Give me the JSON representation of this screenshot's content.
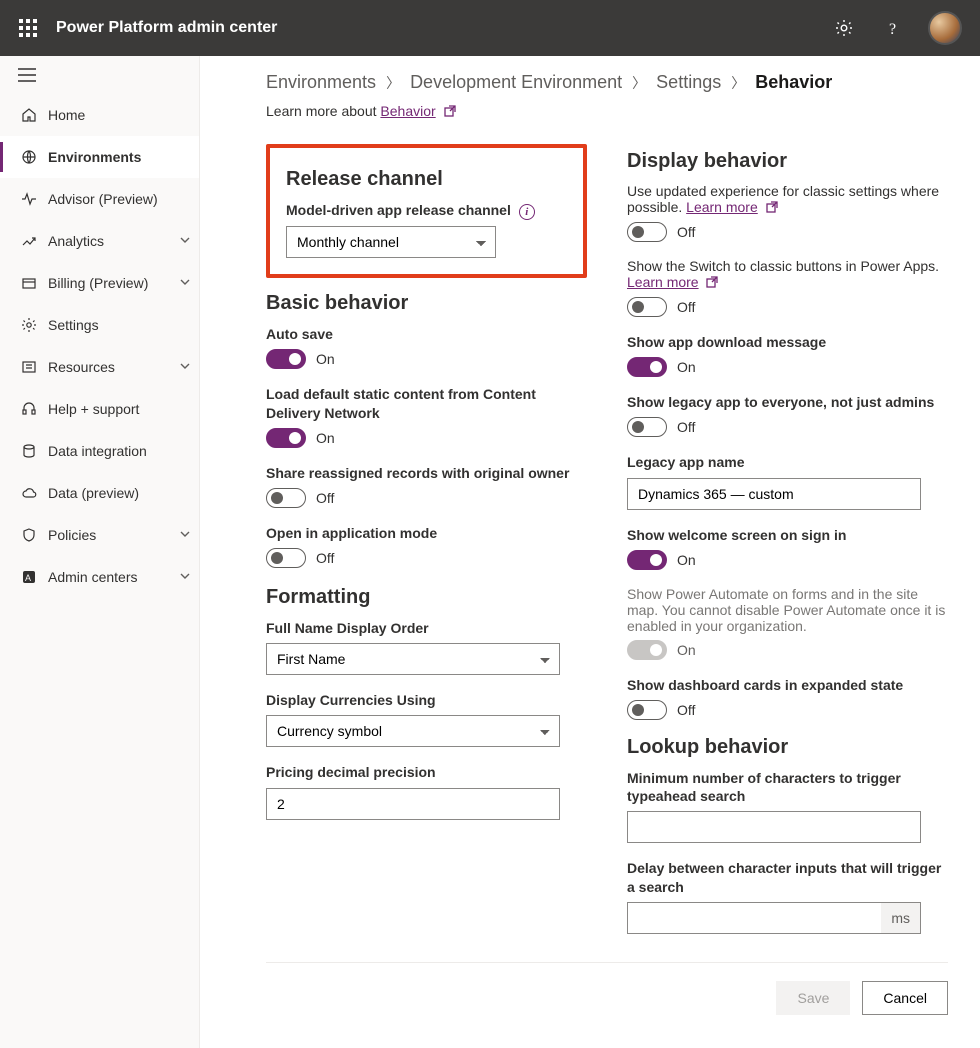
{
  "header": {
    "title": "Power Platform admin center"
  },
  "sidebar": {
    "items": [
      {
        "label": "Home"
      },
      {
        "label": "Environments"
      },
      {
        "label": "Advisor (Preview)"
      },
      {
        "label": "Analytics"
      },
      {
        "label": "Billing (Preview)"
      },
      {
        "label": "Settings"
      },
      {
        "label": "Resources"
      },
      {
        "label": "Help + support"
      },
      {
        "label": "Data integration"
      },
      {
        "label": "Data (preview)"
      },
      {
        "label": "Policies"
      },
      {
        "label": "Admin centers"
      }
    ]
  },
  "breadcrumbs": {
    "items": [
      "Environments",
      "Development Environment",
      "Settings",
      "Behavior"
    ]
  },
  "learn": {
    "prefix": "Learn more about ",
    "link": "Behavior"
  },
  "release": {
    "heading": "Release channel",
    "label": "Model-driven app release channel",
    "value": "Monthly channel"
  },
  "basic": {
    "heading": "Basic behavior",
    "auto_save": {
      "label": "Auto save",
      "state": "On"
    },
    "cdn": {
      "label": "Load default static content from Content Delivery Network",
      "state": "On"
    },
    "share": {
      "label": "Share reassigned records with original owner",
      "state": "Off"
    },
    "appmode": {
      "label": "Open in application mode",
      "state": "Off"
    }
  },
  "formatting": {
    "heading": "Formatting",
    "fullname": {
      "label": "Full Name Display Order",
      "value": "First Name"
    },
    "currency": {
      "label": "Display Currencies Using",
      "value": "Currency symbol"
    },
    "precision": {
      "label": "Pricing decimal precision",
      "value": "2"
    }
  },
  "display": {
    "heading": "Display behavior",
    "updated": {
      "desc": "Use updated experience for classic settings where possible. ",
      "learn": "Learn more",
      "state": "Off"
    },
    "switchbtn": {
      "desc": "Show the Switch to classic buttons in Power Apps. ",
      "learn": "Learn more",
      "state": "Off"
    },
    "download": {
      "label": "Show app download message",
      "state": "On"
    },
    "legacy": {
      "label": "Show legacy app to everyone, not just admins",
      "state": "Off"
    },
    "legacy_name": {
      "label": "Legacy app name",
      "value": "Dynamics 365 — custom"
    },
    "welcome": {
      "label": "Show welcome screen on sign in",
      "state": "On"
    },
    "powerautomate": {
      "desc": "Show Power Automate on forms and in the site map. You cannot disable Power Automate once it is enabled in your organization.",
      "state": "On"
    },
    "dashboard": {
      "label": "Show dashboard cards in expanded state",
      "state": "Off"
    }
  },
  "lookup": {
    "heading": "Lookup behavior",
    "minchars": {
      "label": "Minimum number of characters to trigger typeahead search",
      "value": ""
    },
    "delay": {
      "label": "Delay between character inputs that will trigger a search",
      "value": "",
      "suffix": "ms"
    }
  },
  "footer": {
    "save": "Save",
    "cancel": "Cancel"
  },
  "toggle_labels": {
    "on": "On",
    "off": "Off"
  }
}
